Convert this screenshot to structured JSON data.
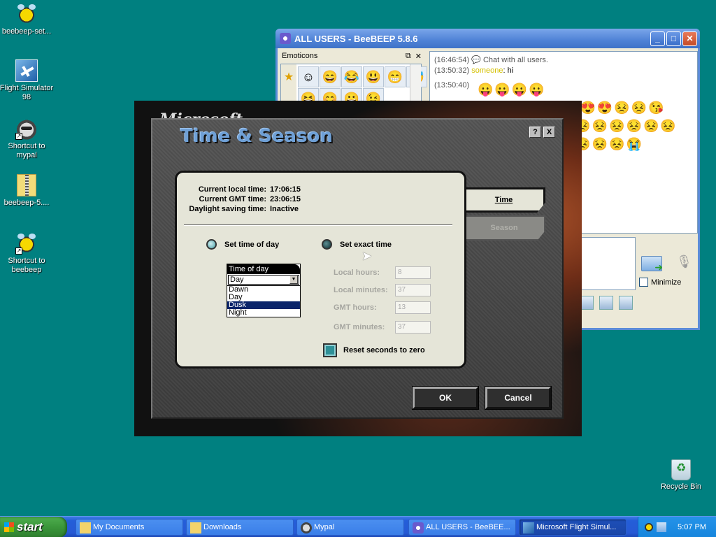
{
  "desktop": {
    "icons": [
      {
        "label": "beebeep-set...",
        "icon": "bee-setup-icon"
      },
      {
        "label": "Flight Simulator 98",
        "icon": "flight-simulator-icon"
      },
      {
        "label": "Shortcut to mypal",
        "icon": "raccoon-icon"
      },
      {
        "label": "beebeep-5....",
        "icon": "zip-folder-icon"
      },
      {
        "label": "Shortcut to beebeep",
        "icon": "bee-icon"
      },
      {
        "label": "Recycle Bin",
        "icon": "recycle-bin-icon"
      }
    ]
  },
  "beebeep": {
    "title": "ALL USERS - BeeBEEP 5.8.6",
    "emoticons_title": "Emoticons",
    "emoticons": [
      "☺",
      "😄",
      "😂",
      "😃",
      "😁",
      "😅",
      "😆",
      "😊",
      "😀",
      "😉"
    ],
    "chat": [
      {
        "time": "(16:46:54)",
        "text": "Chat with all users."
      },
      {
        "time": "(13:50:32)",
        "nick": "someone",
        "text": ": hi"
      },
      {
        "time": "(13:50:40)",
        "text": ""
      }
    ],
    "emoji_rows": [
      "😛😛😛😛",
      "😛😛😛😛😛😛😍😍😣😣😘",
      "😣😣😣😣😣😣😣😣😣😣😣😣😣😣",
      "😣😣😣😣😣😣😣😣😣😣😣😭",
      "😘",
      "😂😂"
    ],
    "minimize_label": "Minimize"
  },
  "backdrop": {
    "brand": "Microsoft"
  },
  "dialog": {
    "title": "Time & Season",
    "help_button": "?",
    "close_button": "X",
    "info": {
      "local_label": "Current local time:",
      "local_value": "17:06:15",
      "gmt_label": "Current GMT time:",
      "gmt_value": "23:06:15",
      "dst_label": "Daylight saving time:",
      "dst_value": "Inactive"
    },
    "radio_time_of_day": "Set time of day",
    "radio_exact_time": "Set exact time",
    "time_of_day_header": "Time of day",
    "time_of_day_selected": "Day",
    "time_of_day_options": [
      "Dawn",
      "Day",
      "Dusk",
      "Night"
    ],
    "time_of_day_highlighted": "Dusk",
    "fields": [
      {
        "label": "Local hours:",
        "value": "8"
      },
      {
        "label": "Local minutes:",
        "value": "37"
      },
      {
        "label": "GMT hours:",
        "value": "13"
      },
      {
        "label": "GMT minutes:",
        "value": "37"
      }
    ],
    "reset_label": "Reset seconds to zero",
    "tab_time": "Time",
    "tab_season": "Season",
    "ok": "OK",
    "cancel": "Cancel"
  },
  "taskbar": {
    "start": "start",
    "tasks": [
      {
        "label": "My Documents"
      },
      {
        "label": "Downloads"
      },
      {
        "label": "Mypal"
      },
      {
        "label": "ALL USERS - BeeBEE..."
      },
      {
        "label": "Microsoft Flight Simul..."
      }
    ],
    "clock": "5:07 PM"
  }
}
